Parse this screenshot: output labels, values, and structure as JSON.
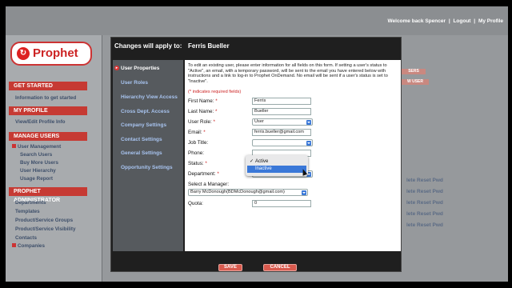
{
  "topbar": {
    "welcome": "Welcome back Spencer",
    "sep1": "|",
    "logout": "Logout",
    "sep2": "|",
    "my_profile": "My Profile"
  },
  "logo": {
    "text": "Prophet"
  },
  "sidebar": {
    "get_started": "GET STARTED",
    "get_started_item": "Information to get started",
    "my_profile": "MY PROFILE",
    "my_profile_item": "View/Edit Profile Info",
    "manage_users": "MANAGE USERS",
    "user_management": "User Management",
    "search_users": "Search Users",
    "buy_more_users": "Buy More Users",
    "user_hierarchy": "User Hierarchy",
    "usage_report": "Usage Report",
    "prophet_admin": "PROPHET ADMINISTRATOR",
    "departments": "Departments",
    "templates": "Templates",
    "product_groups": "Product/Service Groups",
    "product_visibility": "Product/Service Visibility",
    "contacts": "Contacts",
    "companies": "Companies"
  },
  "background": {
    "rows": [
      "lete  Reset Pwd",
      "lete  Reset Pwd",
      "lete  Reset Pwd",
      "lete  Reset Pwd",
      "lete  Reset Pwd"
    ],
    "users_btn": "SERS",
    "new_user_btn": "W USER"
  },
  "modal": {
    "title": "Changes will apply to:",
    "name": "Ferris Bueller",
    "tabs": [
      "User Properties",
      "User Roles",
      "Hierarchy View Access",
      "Cross Dept. Access",
      "Company Settings",
      "Contact Settings",
      "General Settings",
      "Opportunity Settings"
    ],
    "intro": "To edit an existing user, please enter information for all fields on this form. If setting a user's status to \"Active\", an email, with a temporary password, will be sent to the email you have entered below with instructions and a link to log-in to Prophet OnDemand. No email will be sent if a user's status is set to \"Inactive\".",
    "required_note": "(* indicates required fields)",
    "fields": {
      "first_name_label": "First Name:",
      "first_name": "Ferris",
      "last_name_label": "Last Name:",
      "last_name": "Bueller",
      "user_role_label": "User Role:",
      "user_role": "User",
      "email_label": "Email:",
      "email": "ferris.bueller@gmail.com",
      "job_title_label": "Job Title:",
      "phone_label": "Phone:",
      "status_label": "Status:",
      "department_label": "Department:",
      "manager_label": "Select a Manager:",
      "manager": "Barry McDonough(BDMcDonough@gmail.com)",
      "quota_label": "Quota:",
      "quota": "0",
      "asterisk": "*"
    },
    "status_options": [
      "Active",
      "Inactive"
    ],
    "status_checked": "✓",
    "save": "SAVE",
    "cancel": "CANCEL"
  }
}
